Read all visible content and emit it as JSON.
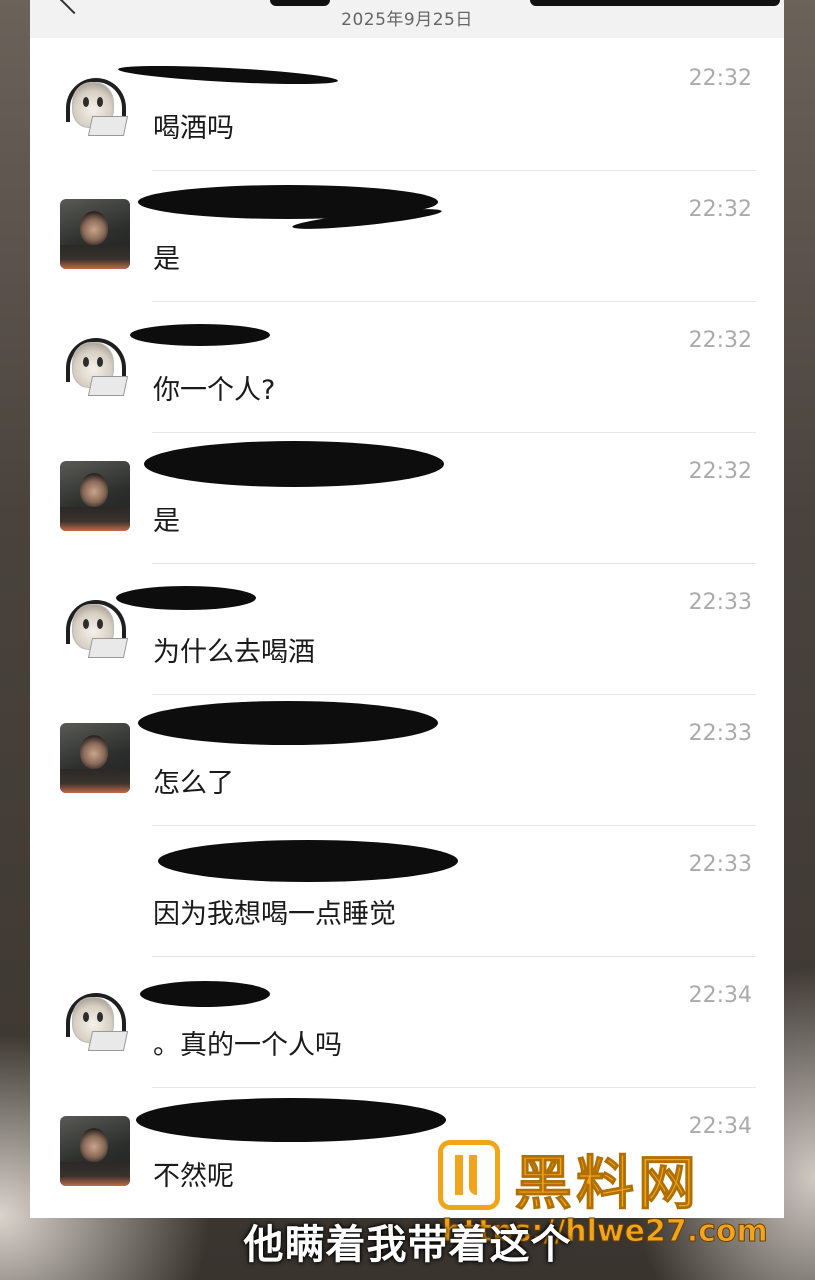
{
  "header": {
    "date": "2025年9月25日"
  },
  "messages": [
    {
      "time": "22:32",
      "text": "喝酒吗",
      "avatar": "cat-avatar"
    },
    {
      "time": "22:32",
      "text": "是",
      "avatar": "person-avatar"
    },
    {
      "time": "22:32",
      "text": "你一个人?",
      "avatar": "cat-avatar"
    },
    {
      "time": "22:32",
      "text": "是",
      "avatar": "person-avatar"
    },
    {
      "time": "22:33",
      "text": "为什么去喝酒",
      "avatar": "cat-avatar"
    },
    {
      "time": "22:33",
      "text": "怎么了",
      "avatar": "person-avatar"
    },
    {
      "time": "22:33",
      "text": "因为我想喝一点睡觉",
      "avatar": "none"
    },
    {
      "time": "22:34",
      "text": "。真的一个人吗",
      "avatar": "cat-avatar"
    },
    {
      "time": "22:34",
      "text": "不然呢",
      "avatar": "person-avatar"
    }
  ],
  "overlay": {
    "subtitle": "他瞒着我带着这个",
    "watermark_title": "黑料网",
    "watermark_url": "https://hlwe27.com"
  },
  "colors": {
    "accent": "#f2a51a",
    "time_text": "#aaaaaa",
    "message_text": "#1a1a1a"
  }
}
